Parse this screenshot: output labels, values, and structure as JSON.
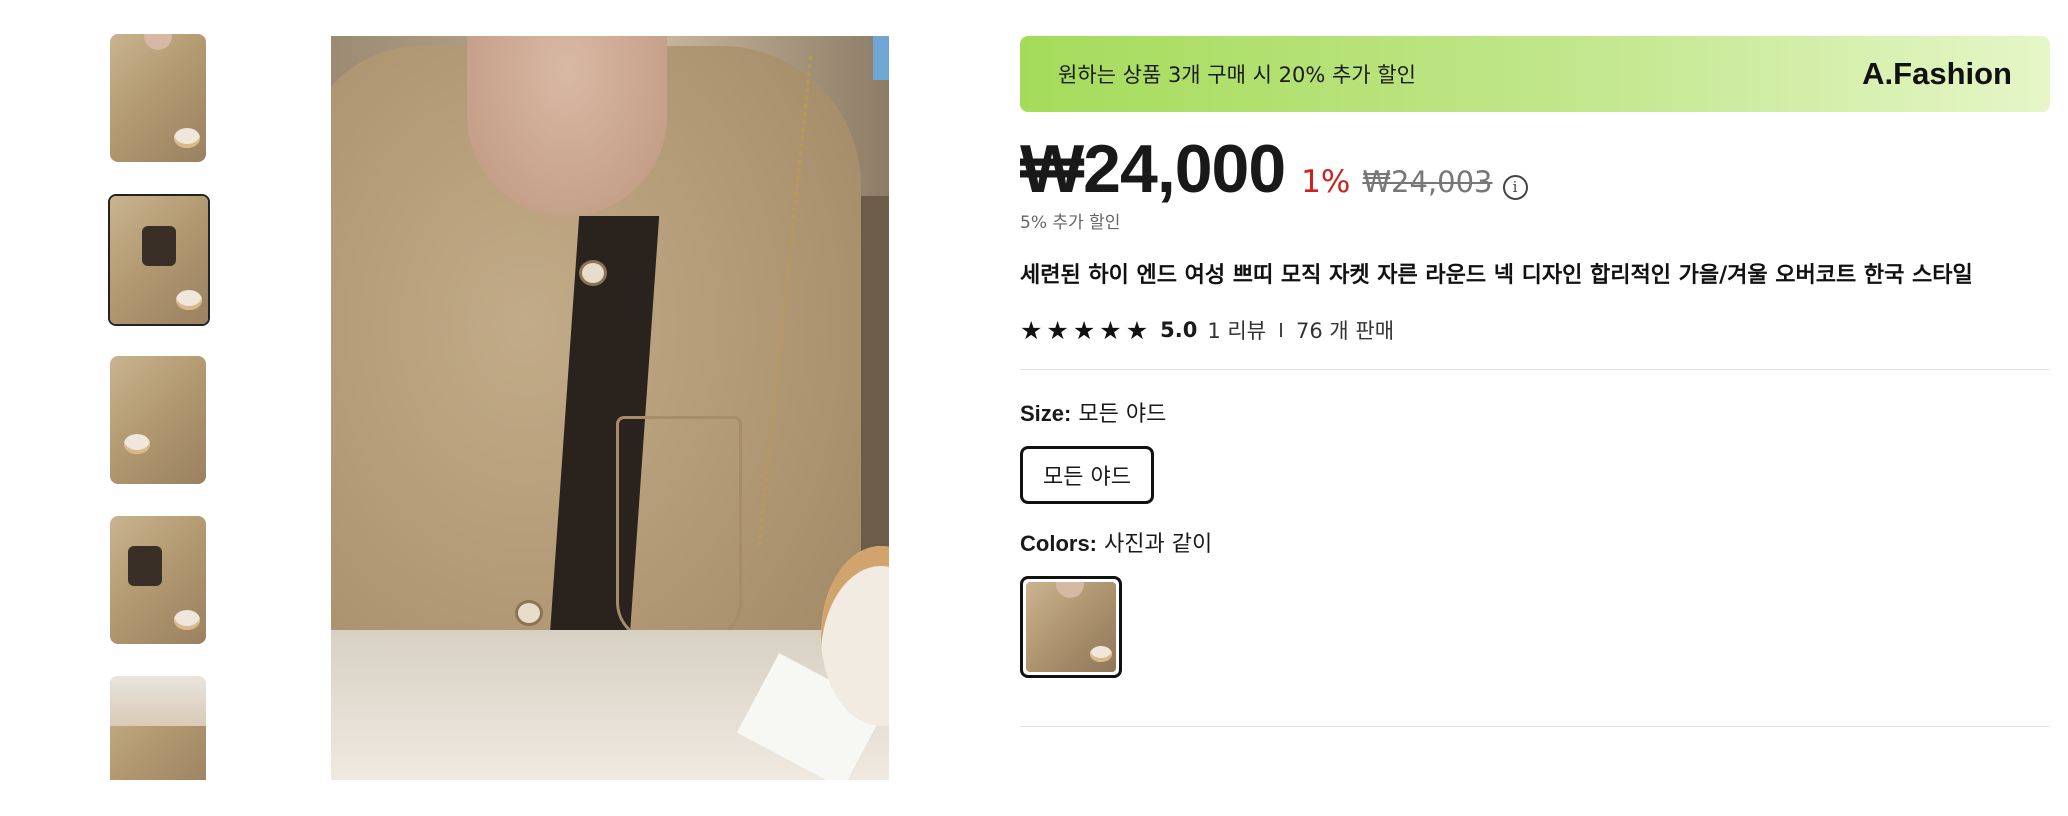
{
  "gallery": {
    "thumbnails": [
      {
        "alt": "thumbnail-1",
        "selected": false
      },
      {
        "alt": "thumbnail-2",
        "selected": true
      },
      {
        "alt": "thumbnail-3",
        "selected": false
      },
      {
        "alt": "thumbnail-4",
        "selected": false
      },
      {
        "alt": "thumbnail-5",
        "selected": false
      }
    ]
  },
  "promo": {
    "text": "원하는 상품 3개 구매 시 20% 추가 할인",
    "brand": "A.Fashion"
  },
  "price": {
    "current": "₩24,000",
    "discount": "1%",
    "original": "₩24,003",
    "extra_discount": "5% 추가 할인",
    "info_icon": "i"
  },
  "product": {
    "title": "세련된 하이 엔드 여성 쁘띠 모직 자켓 자른 라운드 넥 디자인 합리적인 가을/겨울 오버코트 한국 스타일"
  },
  "rating": {
    "stars": 5,
    "star_glyph": "★",
    "score": "5.0",
    "reviews": "1 리뷰",
    "sold": "76 개 판매"
  },
  "options": {
    "size_label": "Size:",
    "size_value": "모든 야드",
    "size_button": "모든 야드",
    "color_label": "Colors:",
    "color_value": "사진과 같이"
  },
  "colors": {
    "discount_red": "#d0211c",
    "promo_green": "#a5db5a"
  }
}
